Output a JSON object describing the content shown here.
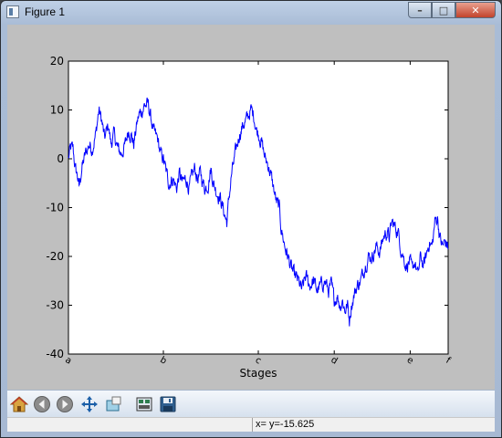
{
  "window": {
    "title": "Figure 1",
    "min_glyph": "–",
    "max_glyph": "□",
    "close_glyph": "✕"
  },
  "toolbar": {
    "buttons": [
      {
        "name": "home-button",
        "icon": "home-icon"
      },
      {
        "name": "back-button",
        "icon": "arrow-left-icon"
      },
      {
        "name": "forward-button",
        "icon": "arrow-right-icon"
      },
      {
        "name": "pan-button",
        "icon": "pan-icon"
      },
      {
        "name": "zoom-button",
        "icon": "zoom-rect-icon"
      },
      {
        "name": "subplots-button",
        "icon": "subplots-icon"
      },
      {
        "name": "save-button",
        "icon": "save-icon"
      }
    ]
  },
  "status": {
    "text": "x= y=-15.625"
  },
  "colors": {
    "line": "#0000ff",
    "figure_bg": "#bfbfbf",
    "axes_bg": "#ffffff"
  },
  "chart_data": {
    "type": "line",
    "xlabel": "Stages",
    "ylabel": "",
    "title": "",
    "xlim": [
      0,
      1000
    ],
    "ylim": [
      -40,
      20
    ],
    "yticks": [
      20,
      10,
      0,
      -10,
      -20,
      -30,
      -40
    ],
    "xticks": [
      0,
      250,
      500,
      700,
      900,
      1000
    ],
    "xticklabels": [
      "a",
      "b",
      "c",
      "d",
      "e",
      "f"
    ],
    "xtick_rotation_deg": 30,
    "grid": false,
    "keypoints": [
      [
        0,
        0
      ],
      [
        5,
        2
      ],
      [
        12,
        2
      ],
      [
        18,
        -2
      ],
      [
        25,
        -4
      ],
      [
        28,
        -6
      ],
      [
        35,
        -2
      ],
      [
        45,
        1
      ],
      [
        55,
        3
      ],
      [
        62,
        2
      ],
      [
        72,
        5
      ],
      [
        80,
        10
      ],
      [
        87,
        8
      ],
      [
        95,
        4
      ],
      [
        105,
        7
      ],
      [
        112,
        3
      ],
      [
        120,
        5
      ],
      [
        130,
        2
      ],
      [
        140,
        1
      ],
      [
        150,
        3
      ],
      [
        158,
        6
      ],
      [
        165,
        5
      ],
      [
        172,
        3
      ],
      [
        180,
        7
      ],
      [
        186,
        9
      ],
      [
        195,
        10
      ],
      [
        200,
        11
      ],
      [
        210,
        11
      ],
      [
        218,
        8
      ],
      [
        226,
        5
      ],
      [
        235,
        4
      ],
      [
        242,
        1
      ],
      [
        250,
        0
      ],
      [
        258,
        -3
      ],
      [
        265,
        -5
      ],
      [
        275,
        -4
      ],
      [
        285,
        -6
      ],
      [
        292,
        -3
      ],
      [
        300,
        -5
      ],
      [
        310,
        -4
      ],
      [
        318,
        -6
      ],
      [
        325,
        -4
      ],
      [
        332,
        -2
      ],
      [
        340,
        -4
      ],
      [
        348,
        -3
      ],
      [
        355,
        -5
      ],
      [
        360,
        -6
      ],
      [
        368,
        -5
      ],
      [
        375,
        -2
      ],
      [
        382,
        -5
      ],
      [
        392,
        -7
      ],
      [
        400,
        -8
      ],
      [
        410,
        -11
      ],
      [
        417,
        -13
      ],
      [
        423,
        -8
      ],
      [
        430,
        -3
      ],
      [
        440,
        1
      ],
      [
        450,
        5
      ],
      [
        460,
        7
      ],
      [
        470,
        8
      ],
      [
        480,
        10
      ],
      [
        488,
        9
      ],
      [
        495,
        6
      ],
      [
        502,
        5
      ],
      [
        510,
        3
      ],
      [
        518,
        0
      ],
      [
        525,
        -1
      ],
      [
        532,
        -3
      ],
      [
        540,
        -6
      ],
      [
        548,
        -9
      ],
      [
        555,
        -10
      ],
      [
        560,
        -14
      ],
      [
        565,
        -16
      ],
      [
        570,
        -18
      ],
      [
        578,
        -20
      ],
      [
        585,
        -22
      ],
      [
        595,
        -24
      ],
      [
        605,
        -25
      ],
      [
        615,
        -27
      ],
      [
        625,
        -24
      ],
      [
        635,
        -26
      ],
      [
        645,
        -25
      ],
      [
        655,
        -27
      ],
      [
        665,
        -26
      ],
      [
        675,
        -25
      ],
      [
        685,
        -27
      ],
      [
        692,
        -26
      ],
      [
        700,
        -29
      ],
      [
        708,
        -28
      ],
      [
        715,
        -30
      ],
      [
        722,
        -29
      ],
      [
        728,
        -31
      ],
      [
        735,
        -30
      ],
      [
        740,
        -33
      ],
      [
        745,
        -30
      ],
      [
        752,
        -28
      ],
      [
        760,
        -26
      ],
      [
        770,
        -25
      ],
      [
        780,
        -22
      ],
      [
        790,
        -20
      ],
      [
        800,
        -20
      ],
      [
        810,
        -18
      ],
      [
        820,
        -19
      ],
      [
        830,
        -16
      ],
      [
        838,
        -15
      ],
      [
        845,
        -16
      ],
      [
        852,
        -13
      ],
      [
        860,
        -14
      ],
      [
        868,
        -15
      ],
      [
        875,
        -18
      ],
      [
        882,
        -20
      ],
      [
        890,
        -22
      ],
      [
        898,
        -21
      ],
      [
        905,
        -23
      ],
      [
        912,
        -21
      ],
      [
        920,
        -24
      ],
      [
        928,
        -20
      ],
      [
        935,
        -22
      ],
      [
        942,
        -20
      ],
      [
        950,
        -17
      ],
      [
        958,
        -18
      ],
      [
        965,
        -13
      ],
      [
        972,
        -12
      ],
      [
        978,
        -16
      ],
      [
        985,
        -18
      ],
      [
        992,
        -17
      ],
      [
        1000,
        -18
      ]
    ],
    "noise_amplitude": 1.1,
    "samples": 1000
  }
}
